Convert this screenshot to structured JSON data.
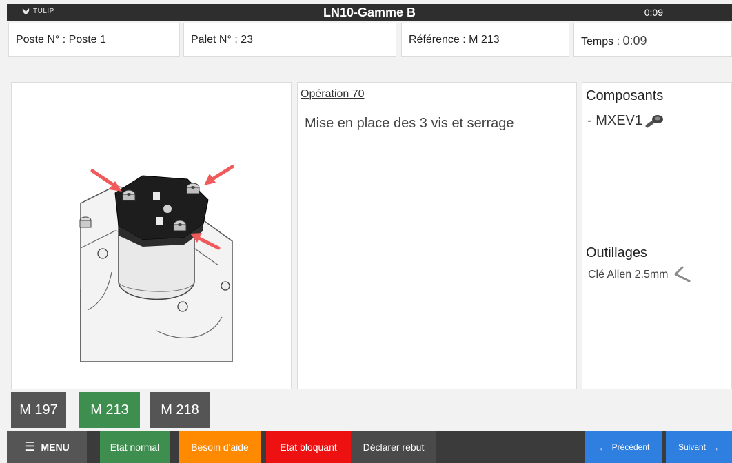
{
  "header": {
    "brand": "TULIP",
    "title": "LN10-Gamme B",
    "clock": "0:09"
  },
  "info": {
    "poste_label": "Poste N° : ",
    "poste_value": "Poste 1",
    "palet_label": "Palet N° : ",
    "palet_value": "23",
    "reference_label": "Référence : ",
    "reference_value": "M 213",
    "temps_label": "Temps : ",
    "temps_value": "0:09"
  },
  "operation": {
    "title": "Opération 70",
    "description": "Mise en place des 3 vis et serrage"
  },
  "composants": {
    "title": "Composants",
    "item": "- MXEV1"
  },
  "outillages": {
    "title": "Outillages",
    "item": "Clé Allen 2.5mm"
  },
  "references": [
    {
      "label": "M 197",
      "color": "#555555"
    },
    {
      "label": "M 213",
      "color": "#3e8e4f"
    },
    {
      "label": "M 218",
      "color": "#555555"
    }
  ],
  "bottom": {
    "menu": "MENU",
    "etat_normal": "Etat normal",
    "besoin_aide": "Besoin d'aide",
    "etat_bloquant": "Etat bloquant",
    "declarer_rebut": "Déclarer rebut",
    "precedent": "Précédent",
    "suivant": "Suivant"
  },
  "colors": {
    "green": "#3e8e4f",
    "orange": "#ff8a00",
    "red": "#ee1111",
    "blue": "#2f7fe0",
    "dark": "#3b3b3b"
  }
}
